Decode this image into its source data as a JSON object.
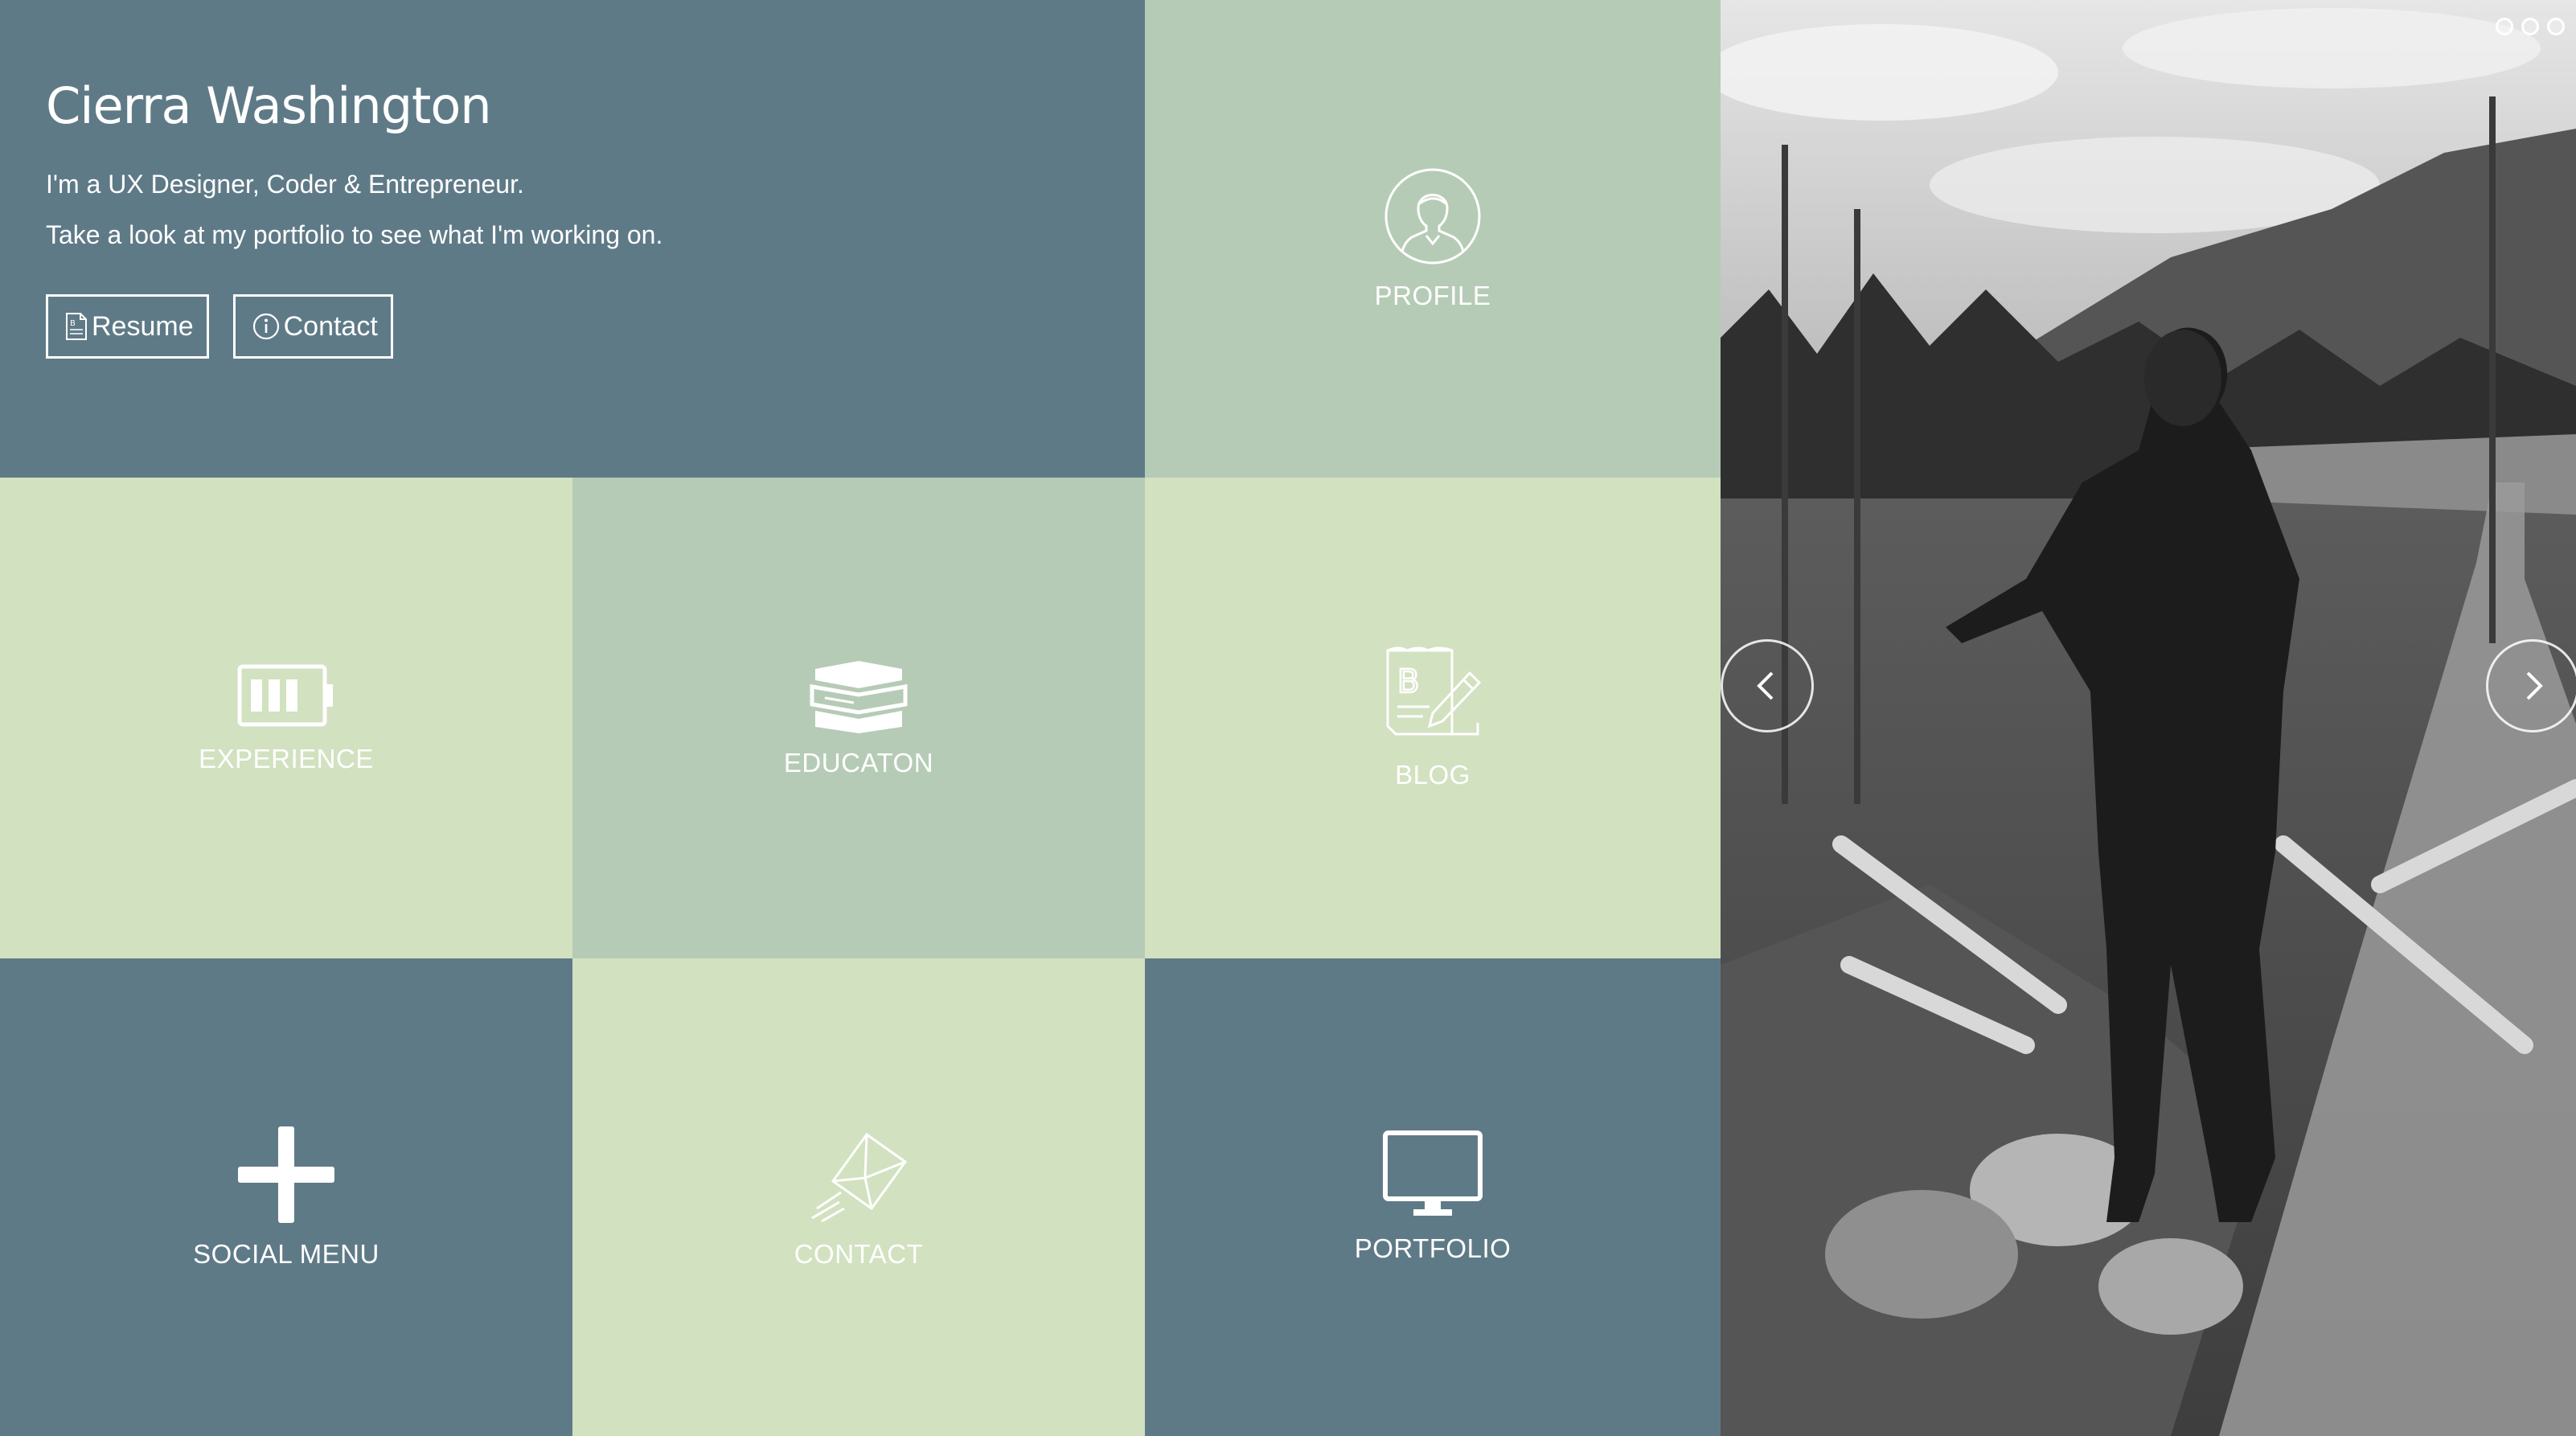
{
  "intro": {
    "name": "Cierra Washington",
    "line1": "I'm a UX Designer, Coder & Entrepreneur.",
    "line2": "Take a look at my portfolio to see what I'm working on.",
    "resume_label": "Resume",
    "contact_label": "Contact"
  },
  "tiles": {
    "profile": "PROFILE",
    "experience": "EXPERIENCE",
    "education": "EDUCATON",
    "blog": "BLOG",
    "social": "SOCIAL MENU",
    "contact": "CONTACT",
    "portfolio": "PORTFOLIO"
  },
  "colors": {
    "slate": "#5f7a87",
    "sage": "#b6cbb6",
    "mint": "#d2e1c0",
    "text": "#ffffff"
  },
  "icons": {
    "profile": "person-circle-icon",
    "experience": "battery-icon",
    "education": "books-icon",
    "blog": "blog-edit-icon",
    "social": "plus-icon",
    "contact": "envelope-icon",
    "portfolio": "monitor-icon",
    "resume": "document-icon",
    "contact_button": "info-icon"
  },
  "carousel": {
    "slide_count": 3,
    "active_slide": 1
  }
}
